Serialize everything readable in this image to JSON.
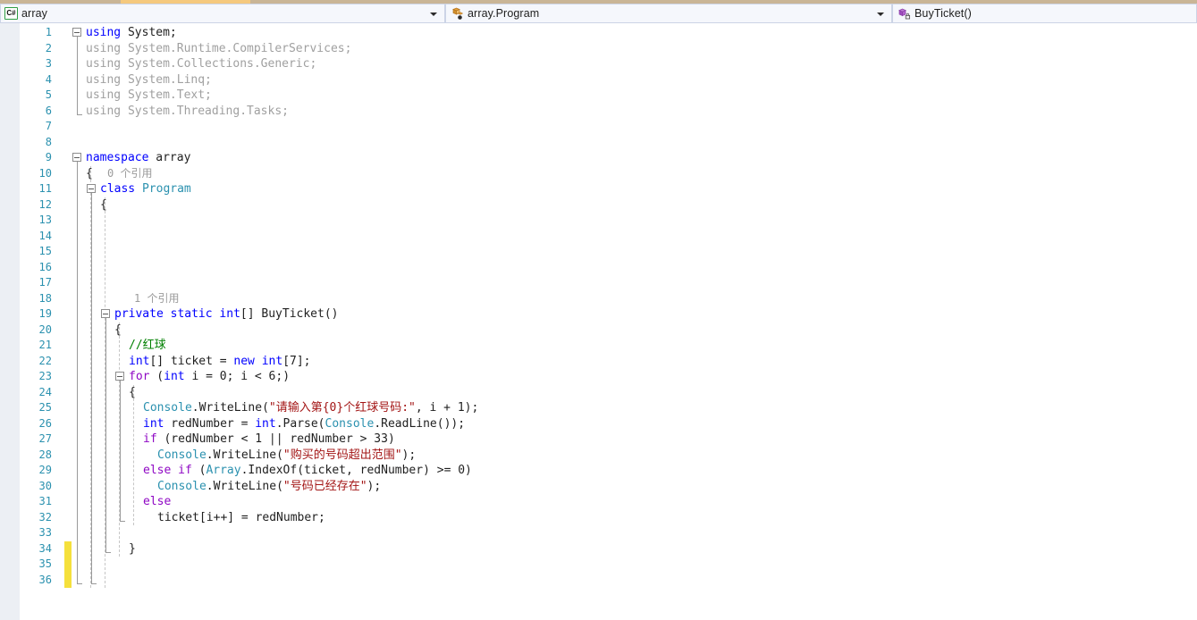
{
  "window": {
    "language": "C#"
  },
  "navbar": {
    "project": {
      "label": "array",
      "icon": "csharp-file-icon"
    },
    "type": {
      "label": "array.Program",
      "icon": "class-icon"
    },
    "member": {
      "label": "BuyTicket()",
      "icon": "private-method-icon"
    },
    "dropdown_icon": "chevron-down-icon"
  },
  "codelens": [
    {
      "line": 10,
      "text": "0 个引用"
    },
    {
      "line": 18,
      "text": "1 个引用"
    }
  ],
  "editor": {
    "first_line": 1,
    "last_line": 36,
    "modified_lines": [
      34,
      35,
      36
    ],
    "change_bar_color": "#f5e03c",
    "line_number_color": "#2b91af",
    "colors": {
      "keyword": "#0000ff",
      "control_keyword": "#8f08c4",
      "type": "#2b91af",
      "string": "#a31515",
      "comment": "#008000",
      "unused": "#a0a0a0",
      "codelens": "#9b9b9b",
      "text": "#1f1f1f"
    },
    "lines": [
      {
        "n": 1,
        "indent": 0,
        "fold": true,
        "tokens": [
          {
            "t": "using",
            "c": "kw"
          },
          {
            "t": " System;",
            "c": "pun"
          }
        ]
      },
      {
        "n": 2,
        "indent": 0,
        "tokens": [
          {
            "t": "using",
            "c": "gray"
          },
          {
            "t": " System.Runtime.CompilerServices;",
            "c": "gray"
          }
        ]
      },
      {
        "n": 3,
        "indent": 0,
        "tokens": [
          {
            "t": "using",
            "c": "gray"
          },
          {
            "t": " System.Collections.Generic;",
            "c": "gray"
          }
        ]
      },
      {
        "n": 4,
        "indent": 0,
        "tokens": [
          {
            "t": "using",
            "c": "gray"
          },
          {
            "t": " System.Linq;",
            "c": "gray"
          }
        ]
      },
      {
        "n": 5,
        "indent": 0,
        "tokens": [
          {
            "t": "using",
            "c": "gray"
          },
          {
            "t": " System.Text;",
            "c": "gray"
          }
        ]
      },
      {
        "n": 6,
        "indent": 0,
        "tokens": [
          {
            "t": "using",
            "c": "gray"
          },
          {
            "t": " System.Threading.Tasks;",
            "c": "gray"
          }
        ]
      },
      {
        "n": 7,
        "indent": 0,
        "tokens": []
      },
      {
        "n": 8,
        "indent": 0,
        "tokens": []
      },
      {
        "n": 9,
        "indent": 0,
        "fold": true,
        "tokens": [
          {
            "t": "namespace",
            "c": "kw"
          },
          {
            "t": " array",
            "c": "pun"
          }
        ]
      },
      {
        "n": 10,
        "indent": 0,
        "tokens": [
          {
            "t": "{",
            "c": "pun"
          }
        ]
      },
      {
        "n": 11,
        "indent": 1,
        "fold": true,
        "tokens": [
          {
            "t": "class",
            "c": "kw"
          },
          {
            "t": " ",
            "c": "pun"
          },
          {
            "t": "Program",
            "c": "typ"
          }
        ]
      },
      {
        "n": 12,
        "indent": 1,
        "tokens": [
          {
            "t": "{",
            "c": "pun"
          }
        ]
      },
      {
        "n": 13,
        "indent": 0,
        "tokens": []
      },
      {
        "n": 14,
        "indent": 0,
        "tokens": []
      },
      {
        "n": 15,
        "indent": 0,
        "tokens": []
      },
      {
        "n": 16,
        "indent": 0,
        "tokens": []
      },
      {
        "n": 17,
        "indent": 0,
        "tokens": []
      },
      {
        "n": 18,
        "indent": 0,
        "tokens": []
      },
      {
        "n": 19,
        "indent": 2,
        "fold": true,
        "tokens": [
          {
            "t": "private",
            "c": "kw"
          },
          {
            "t": " ",
            "c": "pun"
          },
          {
            "t": "static",
            "c": "kw"
          },
          {
            "t": " ",
            "c": "pun"
          },
          {
            "t": "int",
            "c": "kw"
          },
          {
            "t": "[] BuyTicket()",
            "c": "pun"
          }
        ]
      },
      {
        "n": 20,
        "indent": 2,
        "tokens": [
          {
            "t": "{",
            "c": "pun"
          }
        ]
      },
      {
        "n": 21,
        "indent": 3,
        "tokens": [
          {
            "t": "//红球",
            "c": "cmt"
          }
        ]
      },
      {
        "n": 22,
        "indent": 3,
        "tokens": [
          {
            "t": "int",
            "c": "kw"
          },
          {
            "t": "[] ticket = ",
            "c": "pun"
          },
          {
            "t": "new",
            "c": "kw"
          },
          {
            "t": " ",
            "c": "pun"
          },
          {
            "t": "int",
            "c": "kw"
          },
          {
            "t": "[7];",
            "c": "pun"
          }
        ]
      },
      {
        "n": 23,
        "indent": 3,
        "fold": true,
        "tokens": [
          {
            "t": "for",
            "c": "kwc"
          },
          {
            "t": " (",
            "c": "pun"
          },
          {
            "t": "int",
            "c": "kw"
          },
          {
            "t": " i = 0; i < 6;)",
            "c": "pun"
          }
        ]
      },
      {
        "n": 24,
        "indent": 3,
        "tokens": [
          {
            "t": "{",
            "c": "pun"
          }
        ]
      },
      {
        "n": 25,
        "indent": 4,
        "tokens": [
          {
            "t": "Console",
            "c": "typ"
          },
          {
            "t": ".WriteLine(",
            "c": "pun"
          },
          {
            "t": "\"请输入第{0}个红球号码:\"",
            "c": "str"
          },
          {
            "t": ", i + 1);",
            "c": "pun"
          }
        ]
      },
      {
        "n": 26,
        "indent": 4,
        "tokens": [
          {
            "t": "int",
            "c": "kw"
          },
          {
            "t": " redNumber = ",
            "c": "pun"
          },
          {
            "t": "int",
            "c": "kw"
          },
          {
            "t": ".Parse(",
            "c": "pun"
          },
          {
            "t": "Console",
            "c": "typ"
          },
          {
            "t": ".ReadLine());",
            "c": "pun"
          }
        ]
      },
      {
        "n": 27,
        "indent": 4,
        "tokens": [
          {
            "t": "if",
            "c": "kwc"
          },
          {
            "t": " (redNumber < 1 ",
            "c": "pun"
          },
          {
            "t": "||",
            "c": "pun"
          },
          {
            "t": " redNumber > 33)",
            "c": "pun"
          }
        ]
      },
      {
        "n": 28,
        "indent": 5,
        "tokens": [
          {
            "t": "Console",
            "c": "typ"
          },
          {
            "t": ".WriteLine(",
            "c": "pun"
          },
          {
            "t": "\"购买的号码超出范围\"",
            "c": "str"
          },
          {
            "t": ");",
            "c": "pun"
          }
        ]
      },
      {
        "n": 29,
        "indent": 4,
        "tokens": [
          {
            "t": "else",
            "c": "kwc"
          },
          {
            "t": " ",
            "c": "pun"
          },
          {
            "t": "if",
            "c": "kwc"
          },
          {
            "t": " (",
            "c": "pun"
          },
          {
            "t": "Array",
            "c": "typ"
          },
          {
            "t": ".IndexOf(ticket, redNumber) >= 0)",
            "c": "pun"
          }
        ]
      },
      {
        "n": 30,
        "indent": 5,
        "tokens": [
          {
            "t": "Console",
            "c": "typ"
          },
          {
            "t": ".WriteLine(",
            "c": "pun"
          },
          {
            "t": "\"号码已经存在\"",
            "c": "str"
          },
          {
            "t": ");",
            "c": "pun"
          }
        ]
      },
      {
        "n": 31,
        "indent": 4,
        "tokens": [
          {
            "t": "else",
            "c": "kwc"
          }
        ]
      },
      {
        "n": 32,
        "indent": 5,
        "tokens": [
          {
            "t": "ticket[i++] = redNumber;",
            "c": "pun"
          }
        ]
      },
      {
        "n": 33,
        "indent": 0,
        "tokens": []
      },
      {
        "n": 34,
        "indent": 3,
        "tokens": [
          {
            "t": "}",
            "c": "pun"
          }
        ]
      },
      {
        "n": 35,
        "indent": 0,
        "tokens": []
      },
      {
        "n": 36,
        "indent": 0,
        "tokens": []
      }
    ]
  }
}
